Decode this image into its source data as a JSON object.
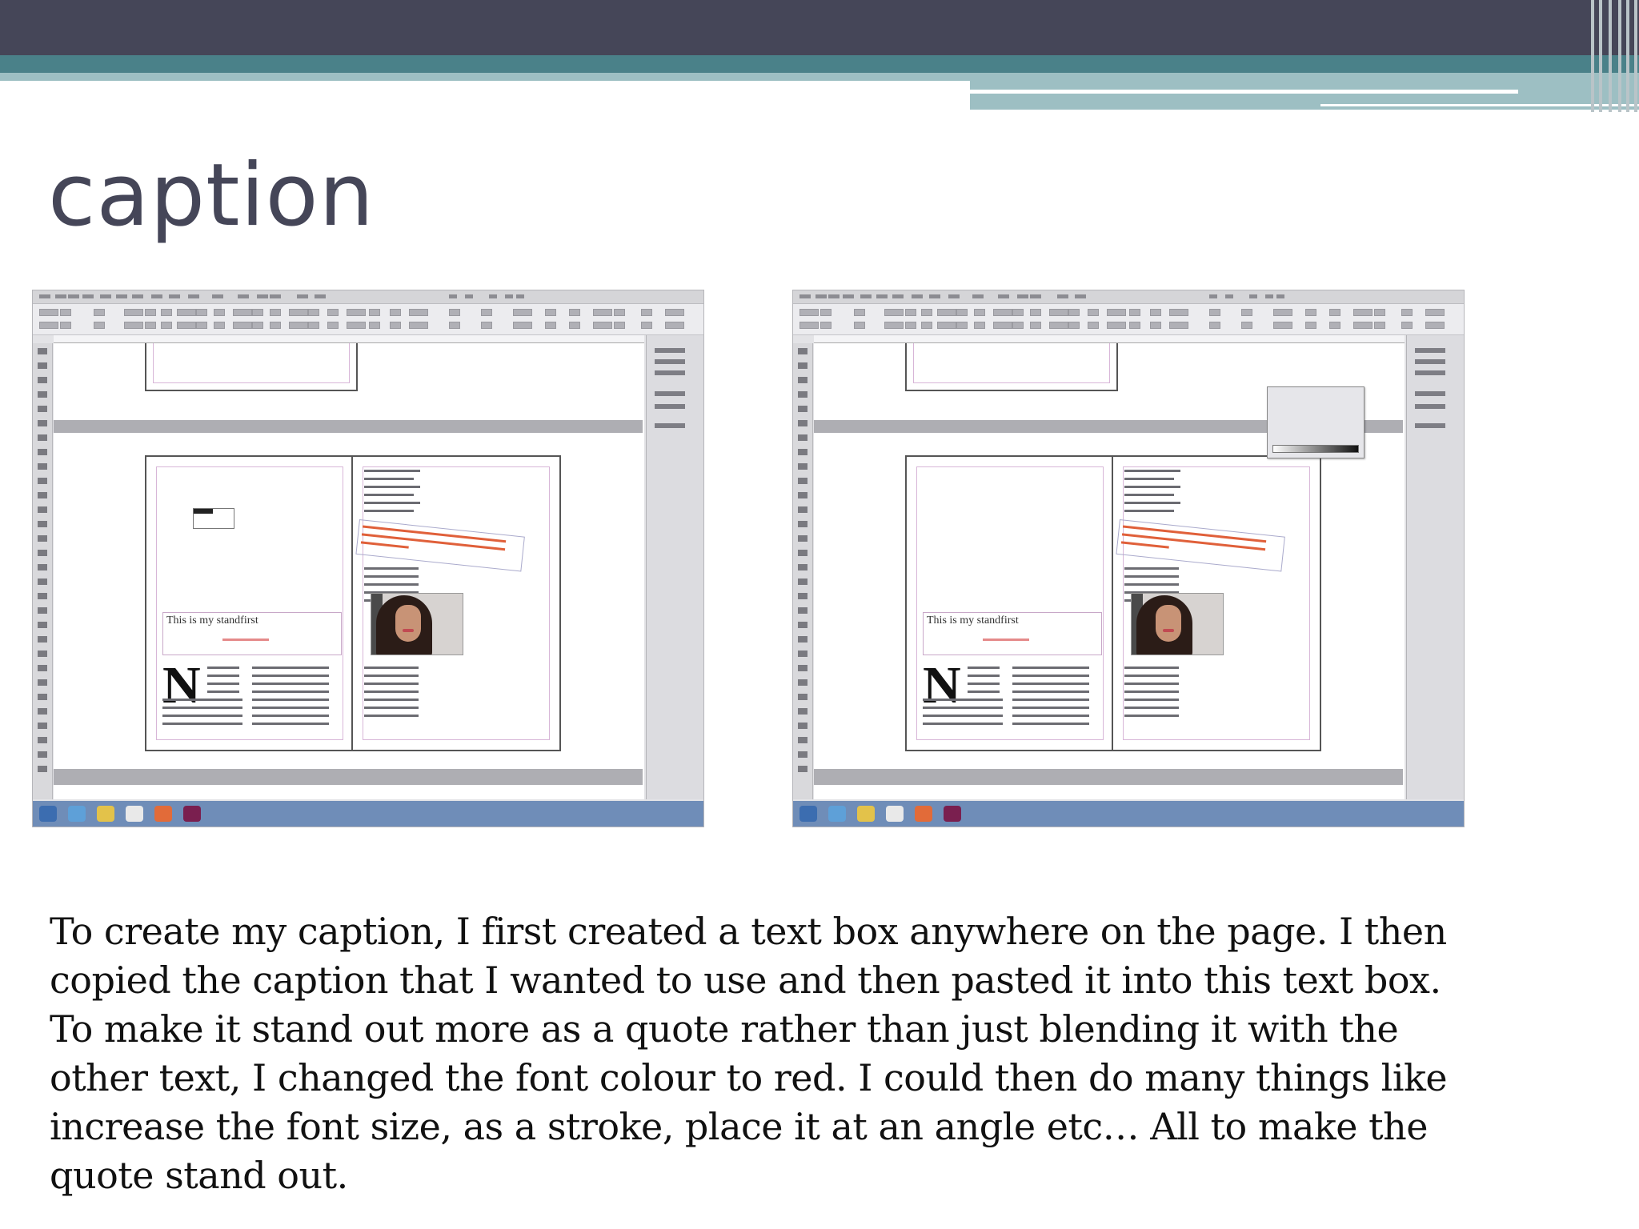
{
  "slide": {
    "title": "caption"
  },
  "colors": {
    "header_dark": "#454658",
    "header_teal": "#4a8189",
    "header_pale": "#9dbfc3",
    "title_text": "#454658",
    "quote_red": "#e0603a"
  },
  "screenshots": [
    {
      "label": "indesign-screenshot-before",
      "standfirst": "This is my standfirst",
      "dropcap": "N"
    },
    {
      "label": "indesign-screenshot-after",
      "standfirst": "This is my standfirst",
      "dropcap": "N"
    }
  ],
  "body": {
    "lines": [
      "To create my caption, I first created a text box anywhere on the page. I then",
      "copied the caption that I wanted to use and then pasted it into this text box.",
      "To make it stand out more as a quote rather than just blending it with the",
      "other text, I changed the font colour to red. I could then do many things like",
      "increase the font size, as a stroke, place it at an angle etc… All to make the",
      "quote stand out."
    ]
  }
}
